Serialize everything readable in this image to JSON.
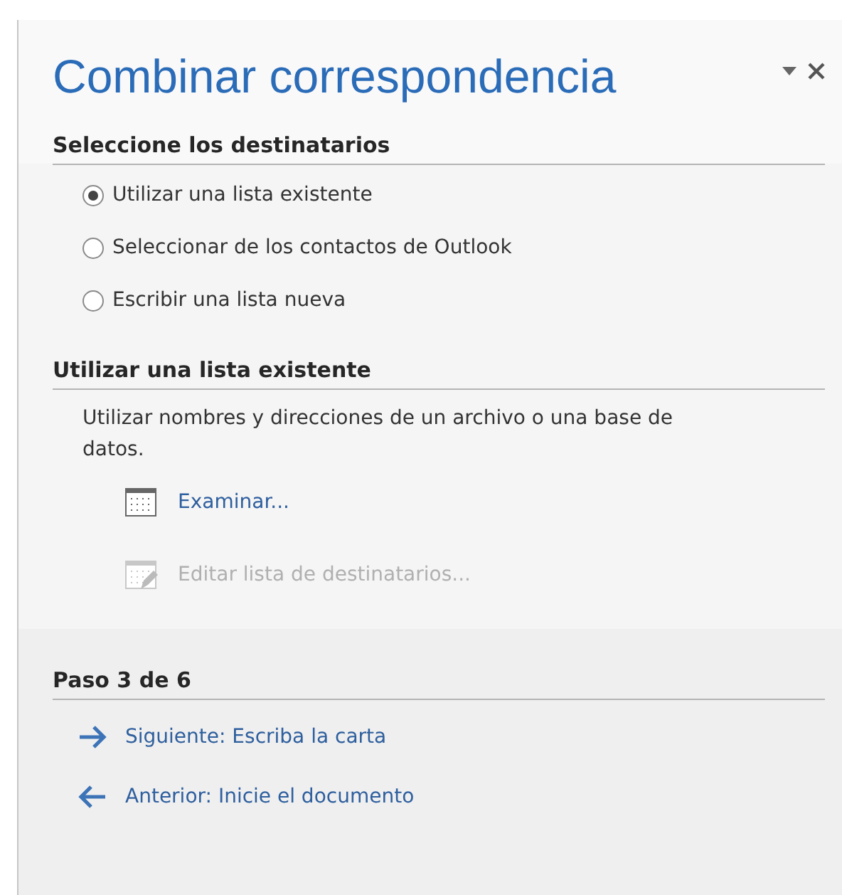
{
  "title": "Combinar correspondencia",
  "recipients": {
    "heading": "Seleccione los destinatarios",
    "options": [
      {
        "label": "Utilizar una lista existente",
        "selected": true
      },
      {
        "label": "Seleccionar de los contactos de Outlook",
        "selected": false
      },
      {
        "label": "Escribir una lista nueva",
        "selected": false
      }
    ]
  },
  "existing_list": {
    "heading": "Utilizar una lista existente",
    "description": "Utilizar nombres y direcciones de un archivo o una base de datos.",
    "actions": [
      {
        "label": "Examinar...",
        "disabled": false
      },
      {
        "label": "Editar lista de destinatarios...",
        "disabled": true
      }
    ]
  },
  "step": {
    "heading": "Paso 3 de 6",
    "links": [
      {
        "kind": "next",
        "label": "Siguiente: Escriba la carta"
      },
      {
        "kind": "previous",
        "label": "Anterior: Inicie el documento"
      }
    ]
  }
}
